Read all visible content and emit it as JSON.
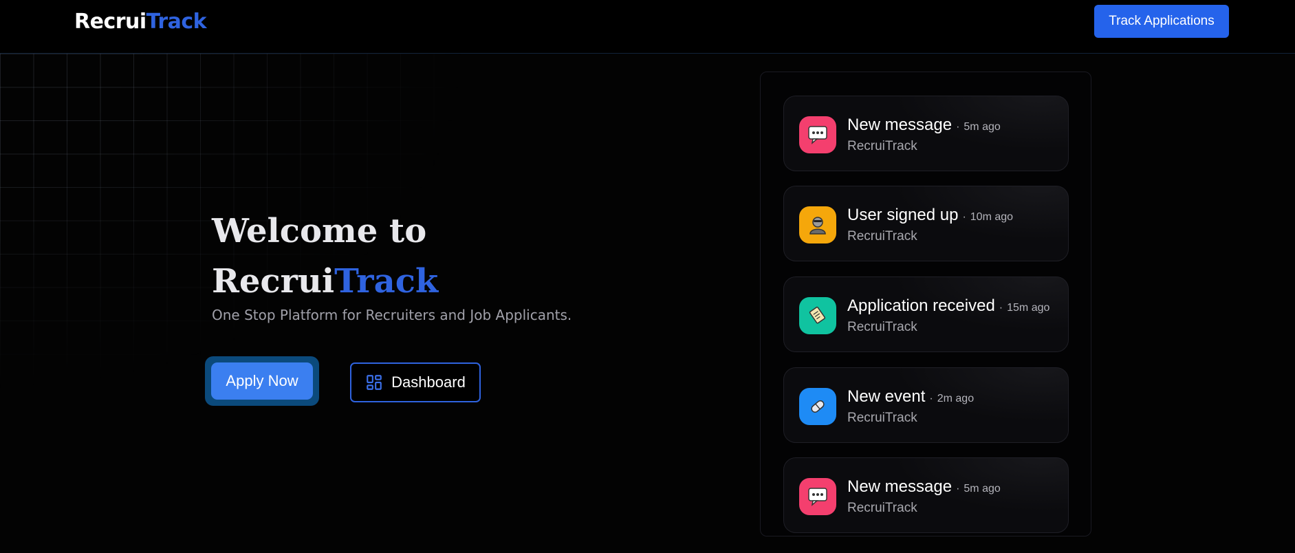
{
  "header": {
    "logo_part1": "Recrui",
    "logo_part2": "Track",
    "track_button": "Track Applications"
  },
  "hero": {
    "title_line1": "Welcome to",
    "title_part1": "Recrui",
    "title_part2": "Track",
    "subtitle": "One Stop Platform for Recruiters and Job Applicants.",
    "apply_button": "Apply Now",
    "dashboard_button": "Dashboard"
  },
  "colors": {
    "accent": "#2563eb",
    "brand_blue": "#2f63e0",
    "message_icon_bg": "#f43f6e",
    "user_icon_bg": "#f5a70b",
    "application_icon_bg": "#10c3a0",
    "event_icon_bg": "#1e8bf5"
  },
  "notifications": [
    {
      "title": "New message",
      "time": "5m ago",
      "source": "RecruiTrack",
      "icon": "chat-bubble-icon"
    },
    {
      "title": "User signed up",
      "time": "10m ago",
      "source": "RecruiTrack",
      "icon": "user-icon"
    },
    {
      "title": "Application received",
      "time": "15m ago",
      "source": "RecruiTrack",
      "icon": "document-icon"
    },
    {
      "title": "New event",
      "time": "2m ago",
      "source": "RecruiTrack",
      "icon": "event-icon"
    },
    {
      "title": "New message",
      "time": "5m ago",
      "source": "RecruiTrack",
      "icon": "chat-bubble-icon"
    }
  ]
}
